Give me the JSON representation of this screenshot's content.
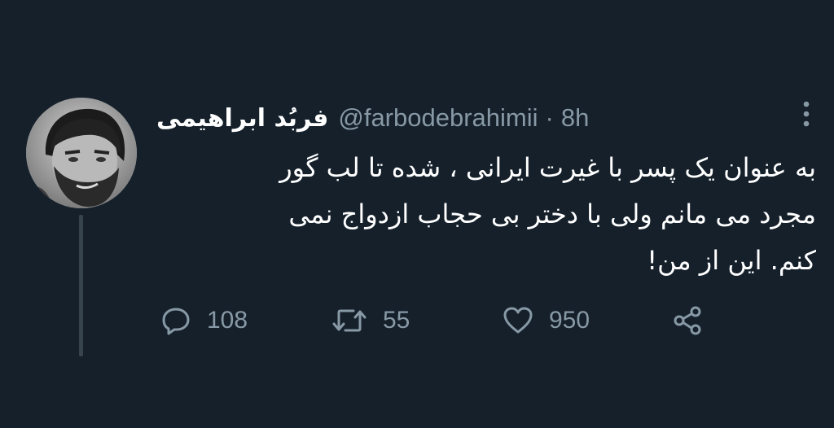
{
  "tweet": {
    "display_name": "فربُد ابراهیمی",
    "handle": "@farbodebrahimii",
    "separator": "·",
    "time": "8h",
    "text_lines": [
      "به عنوان یک پسر با غیرت ایرانی ، شده تا لب گور",
      "مجرد می مانم ولی با دختر بی حجاب ازدواج نمی",
      "کنم. این از من!"
    ],
    "stats": {
      "replies": "108",
      "retweets": "55",
      "likes": "950"
    }
  },
  "icons": {
    "more": "more-vertical-icon",
    "reply": "reply-icon",
    "retweet": "retweet-icon",
    "like": "heart-icon",
    "share": "share-icon"
  },
  "colors": {
    "background": "#15202b",
    "text": "#ffffff",
    "muted": "#8899a6",
    "thread_line": "#38444d"
  }
}
